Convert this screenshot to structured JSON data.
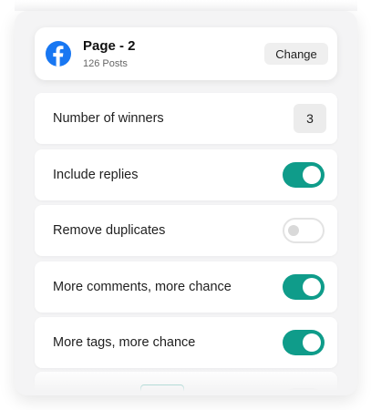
{
  "page": {
    "name": "Page - 2",
    "posts": "126 Posts",
    "change_label": "Change",
    "brand_color": "#1877f2"
  },
  "settings": {
    "winners": {
      "label": "Number of winners",
      "value": "3"
    },
    "rows": [
      {
        "label": "Include replies",
        "enabled": true
      },
      {
        "label": "Remove duplicates",
        "enabled": false
      },
      {
        "label": "More comments, more chance",
        "enabled": true
      },
      {
        "label": "More tags, more chance",
        "enabled": true
      }
    ]
  },
  "colors": {
    "accent": "#0f9c8a",
    "panel_bg": "#f4f4f5"
  },
  "icons": {
    "page_avatar": "facebook-logo-icon"
  }
}
